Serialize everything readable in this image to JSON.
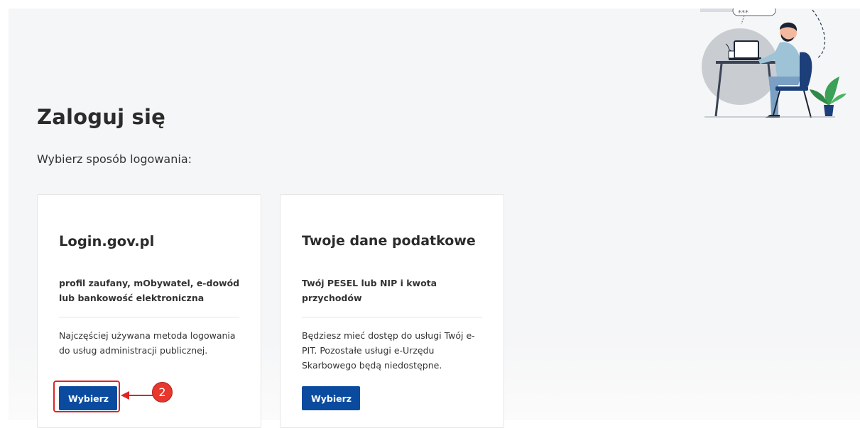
{
  "header": {
    "title": "Zaloguj się",
    "subtitle": "Wybierz sposób logowania:"
  },
  "illustration": {
    "speech_bubble_text": "***",
    "icon": "person-at-laptop-illustration"
  },
  "cards": [
    {
      "title": "Login.gov.pl",
      "description": "profil zaufany, mObywatel, e-dowód lub bankowość elektroniczna",
      "info": "Najczęściej używana metoda logowania do usług administracji publicznej.",
      "button_label": "Wybierz"
    },
    {
      "title": "Twoje dane podatkowe",
      "description": "Twój PESEL lub NIP i kwota przychodów",
      "info": "Będziesz mieć dostęp do usługi Twój e-PIT. Pozostałe usługi e-Urzędu Skarbowego będą niedostępne.",
      "button_label": "Wybierz"
    }
  ],
  "annotation": {
    "step_number": "2",
    "color": "#e02424"
  },
  "colors": {
    "accent": "#0a4ba0",
    "background": "#f5f6f7",
    "illustration_navy": "#1c3f7a",
    "illustration_green": "#3aa157"
  }
}
